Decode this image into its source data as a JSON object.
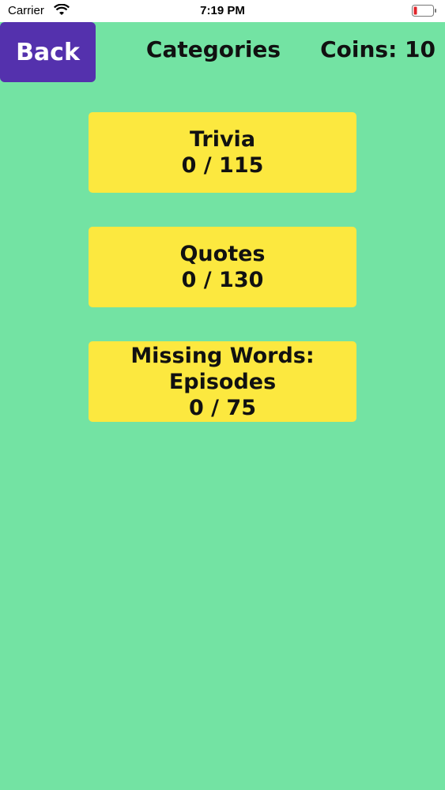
{
  "status_bar": {
    "carrier": "Carrier",
    "time": "7:19 PM"
  },
  "header": {
    "back_label": "Back",
    "title": "Categories",
    "coins": "Coins: 10"
  },
  "categories": [
    {
      "label": "Trivia",
      "progress": "0 / 115"
    },
    {
      "label": "Quotes",
      "progress": "0 / 130"
    },
    {
      "label_line1": "Missing Words:",
      "label_line2": "Episodes",
      "progress": "0 / 75"
    }
  ],
  "colors": {
    "background": "#73e3a3",
    "back_button": "#5431ad",
    "card": "#fce83f"
  }
}
